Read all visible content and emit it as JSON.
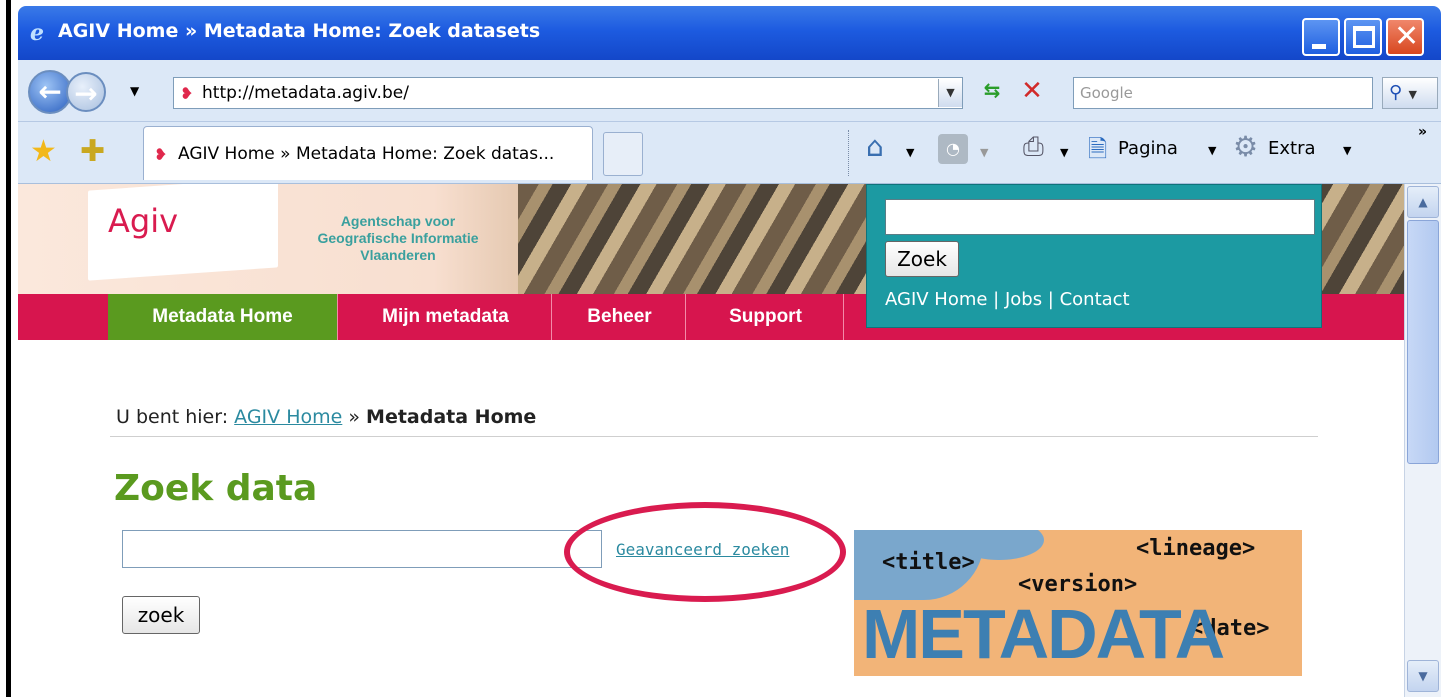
{
  "window": {
    "title": "AGIV Home » Metadata Home: Zoek datasets",
    "app_icon": "ie-icon"
  },
  "addressbar": {
    "url": "http://metadata.agiv.be/",
    "search_placeholder": "Google",
    "search_icon": "magnifier-icon"
  },
  "tabs": [
    {
      "label": "AGIV Home » Metadata Home: Zoek datas..."
    }
  ],
  "command_bar": {
    "page_label": "Pagina",
    "extra_label": "Extra",
    "more": "»"
  },
  "site": {
    "logo": "Agiv",
    "tagline": [
      "Agentschap voor",
      "Geografische Informatie",
      "Vlaanderen"
    ],
    "menu": [
      "Metadata Home",
      "Mijn metadata",
      "Beheer",
      "Support"
    ],
    "header_search": {
      "button": "Zoek",
      "links": "AGIV Home | Jobs | Contact"
    },
    "colors": {
      "menu_red": "#d7154e",
      "menu_active_green": "#5a9a1f",
      "search_teal": "#1c9aa2",
      "heading_green": "#5a9a1f",
      "link_teal": "#2b8aa0",
      "highlight_oval": "#d91b4f"
    }
  },
  "breadcrumb": {
    "prefix": "U bent hier:",
    "link": "AGIV Home",
    "sep": "»",
    "current": "Metadata Home"
  },
  "main": {
    "heading": "Zoek data",
    "advanced_link": "Geavanceerd zoeken",
    "search_button": "zoek"
  },
  "metadata_image": {
    "tags": [
      "<title>",
      "<lineage>",
      "<version>",
      "<date>"
    ],
    "word": "METADATA"
  }
}
